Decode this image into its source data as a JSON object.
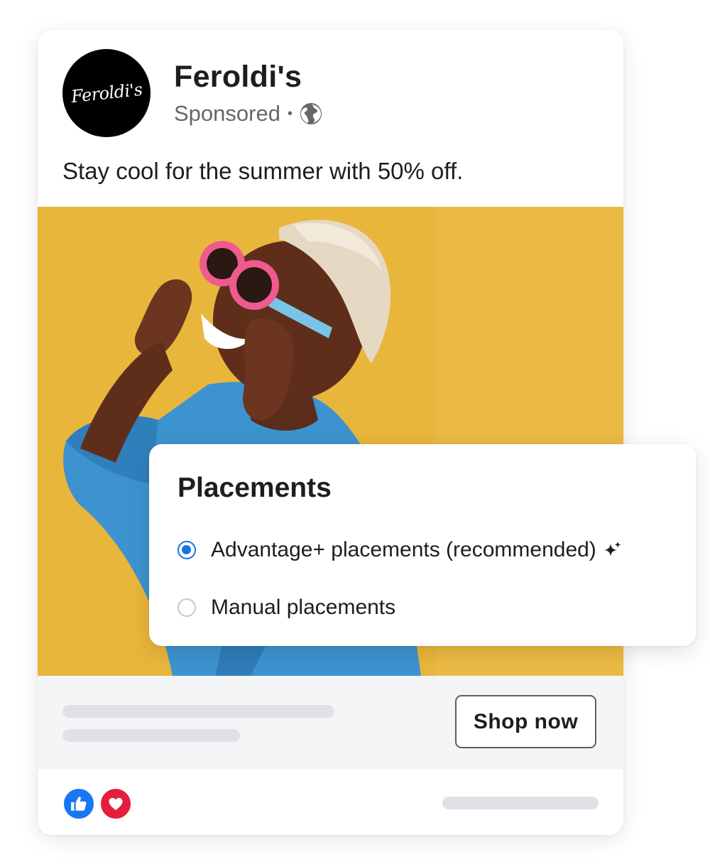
{
  "post": {
    "avatar_logo_text": "Feroldi's",
    "page_name": "Feroldi's",
    "sponsored_label": "Sponsored",
    "separator": "•",
    "caption": "Stay cool for the summer with 50% off.",
    "cta_label": "Shop now"
  },
  "icons": {
    "audience": "globe-icon",
    "reaction_like": "thumbs-up-icon",
    "reaction_love": "heart-icon",
    "recommended": "sparkle-icon"
  },
  "placements": {
    "title": "Placements",
    "options": [
      {
        "label": "Advantage+ placements (recommended)",
        "selected": true
      },
      {
        "label": "Manual placements",
        "selected": false
      }
    ]
  },
  "colors": {
    "image_background": "#e8b53b",
    "accent_blue": "#1b74e4",
    "like_blue": "#1877f2",
    "love_red": "#e41e3f",
    "skeleton_gray": "#dfe1e5"
  }
}
